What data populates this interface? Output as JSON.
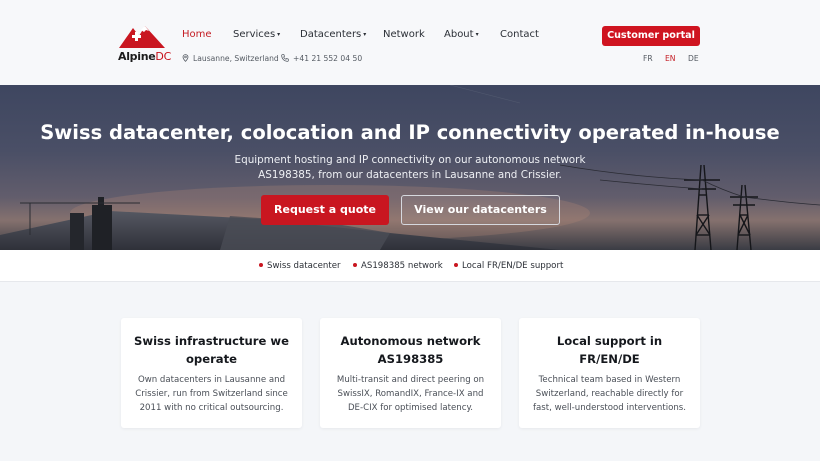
{
  "brand": {
    "name": "Alpine",
    "suffix": "DC",
    "accent": "#c91620"
  },
  "nav": {
    "items": [
      {
        "label": "Home",
        "active": true,
        "dropdown": false
      },
      {
        "label": "Services",
        "active": false,
        "dropdown": true
      },
      {
        "label": "Datacenters",
        "active": false,
        "dropdown": true
      },
      {
        "label": "Network",
        "active": false,
        "dropdown": false
      },
      {
        "label": "About",
        "active": false,
        "dropdown": true
      },
      {
        "label": "Contact",
        "active": false,
        "dropdown": false
      }
    ],
    "dropdown_caret": "▾"
  },
  "contact": {
    "location": "Lausanne, Switzerland",
    "phone": "+41 21 552 04 50",
    "location_icon": "map-pin-icon",
    "phone_icon": "phone-icon"
  },
  "header": {
    "portal_label": "Customer portal",
    "languages": [
      {
        "code": "FR",
        "active": false
      },
      {
        "code": "EN",
        "active": true
      },
      {
        "code": "DE",
        "active": false
      }
    ]
  },
  "hero": {
    "title": "Swiss datacenter, colocation and IP connectivity operated in-house",
    "subtitle_line1": "Equipment hosting and IP connectivity on our autonomous network",
    "subtitle_line2": "AS198385, from our datacenters in Lausanne and Crissier.",
    "primary_cta": "Request a quote",
    "secondary_cta": "View our datacenters"
  },
  "highlights": [
    "Swiss datacenter",
    "AS198385 network",
    "Local FR/EN/DE support"
  ],
  "features": [
    {
      "title_line1": "Swiss infrastructure we",
      "title_line2": "operate",
      "text_line1": "Own datacenters in Lausanne and",
      "text_line2": "Crissier, run from Switzerland since",
      "text_line3": "2011 with no critical outsourcing."
    },
    {
      "title_line1": "Autonomous network",
      "title_line2": "AS198385",
      "text_line1": "Multi-transit and direct peering on",
      "text_line2": "SwissIX, RomandIX, France-IX and",
      "text_line3": "DE-CIX for optimised latency."
    },
    {
      "title_line1": "Local support in",
      "title_line2": "FR/EN/DE",
      "text_line1": "Technical team based in Western",
      "text_line2": "Switzerland, reachable directly for",
      "text_line3": "fast, well-understood interventions."
    }
  ]
}
